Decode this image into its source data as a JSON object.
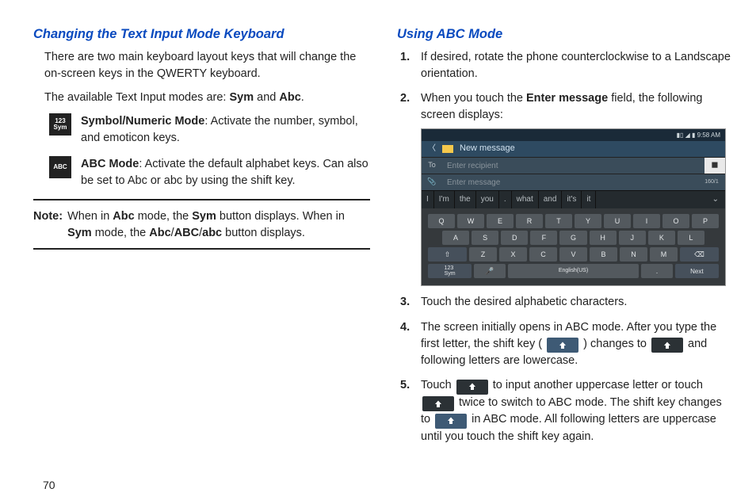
{
  "pageNumber": "70",
  "left": {
    "heading": "Changing the Text Input Mode Keyboard",
    "p1": "There are two main keyboard layout keys that will change the on-screen keys in the QWERTY keyboard.",
    "p2_a": "The available Text Input modes are: ",
    "p2_b1": "Sym",
    "p2_mid": " and ",
    "p2_b2": "Abc",
    "p2_end": ".",
    "sym_icon_l1": "123",
    "sym_icon_l2": "Sym",
    "sym_label": "Symbol/Numeric Mode",
    "sym_text": ": Activate the number, symbol, and emoticon keys.",
    "abc_icon": "ABC",
    "abc_label": "ABC Mode",
    "abc_text": ": Activate the default alphabet keys. Can also be set to Abc or abc by using the shift key.",
    "note_label": "Note:",
    "note_a": "When in ",
    "note_b1": "Abc",
    "note_b": " mode, the ",
    "note_b2": "Sym",
    "note_c": " button displays. When in ",
    "note_b3": "Sym",
    "note_d": " mode, the ",
    "note_b4": "Abc",
    "note_slash1": "/",
    "note_b5": "ABC",
    "note_slash2": "/",
    "note_b6": "abc",
    "note_e": " button displays."
  },
  "right": {
    "heading": "Using ABC Mode",
    "step1": "If desired, rotate the phone counterclockwise to a Landscape orientation.",
    "step2_a": "When you touch the ",
    "step2_b": "Enter message",
    "step2_c": " field, the following screen displays:",
    "step3": "Touch the desired alphabetic characters.",
    "step4_a": "The screen initially opens in ABC mode. After you type the first letter, the shift key ( ",
    "step4_b": " ) changes to ",
    "step4_c": " and following letters are lowercase.",
    "step5_a": "Touch ",
    "step5_b": " to input another uppercase letter or touch ",
    "step5_c": " twice to switch to ABC mode. The shift key changes to ",
    "step5_d": " in ABC mode. All following letters are uppercase until you touch the shift key again."
  },
  "screenshot": {
    "time": "9:58 AM",
    "title": "New message",
    "to": "To",
    "recipient_ph": "Enter recipient",
    "message_ph": "Enter message",
    "counter": "160/1",
    "predict": [
      "I",
      "I'm",
      "the",
      "you",
      ".",
      "what",
      "and",
      "it's",
      "it"
    ],
    "row1": [
      "Q",
      "W",
      "E",
      "R",
      "T",
      "Y",
      "U",
      "I",
      "O",
      "P"
    ],
    "row2": [
      "A",
      "S",
      "D",
      "F",
      "G",
      "H",
      "J",
      "K",
      "L"
    ],
    "row3_keys": [
      "Z",
      "X",
      "C",
      "V",
      "B",
      "N",
      "M"
    ],
    "bs_label": "⌫",
    "sym_label": "123\nSym",
    "mic_label": "🎤",
    "space_label": "English(US)",
    "period_label": ".",
    "next_label": "Next"
  }
}
